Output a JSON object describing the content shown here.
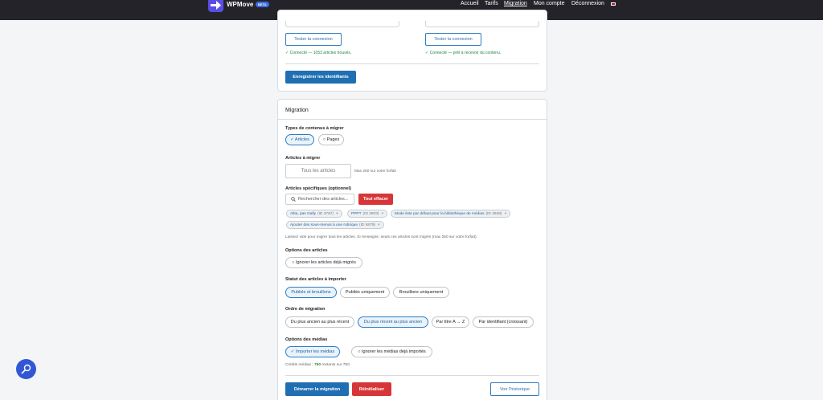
{
  "header": {
    "brand": "WPMove",
    "badge": "BETA",
    "nav": [
      "Accueil",
      "Tarifs",
      "Migration",
      "Mon compte",
      "Déconnexion"
    ],
    "active_nav": "Migration"
  },
  "connection": {
    "test_label": "Tester la connexion",
    "source_status": "✓ Connecté — 1053 articles trouvés.",
    "dest_status": "✓ Connecté — prêt à recevoir du contenu.",
    "save_label": "Enregistrer les identifiants"
  },
  "migration": {
    "title": "Migration",
    "content_types_label": "Types de contenus à migrer",
    "content_types": [
      "✓ Articles",
      "○ Pages"
    ],
    "articles_label": "Articles à migrer",
    "articles_value": "Tous les articles",
    "articles_max": "Max 250 sur votre forfait",
    "specific_label": "Articles spécifiques (optionnel)",
    "search_placeholder": "Rechercher des articles...",
    "clear_label": "Tout effacer",
    "tags": [
      {
        "title": "Alita, pas Gally",
        "id": "(ID 3787)"
      },
      {
        "title": "PPPT",
        "id": "(ID 3803)"
      },
      {
        "title": "Mode liste par défaut pour la bibliothèque de médias",
        "id": "(ID 3638)"
      },
      {
        "title": "Ajouter des sous-menus à une rubrique",
        "id": "(ID 5879)"
      }
    ],
    "help": "Laissez vide pour migrer tous les articles. Si renseigné, seuls ces articles sont migrés (max 250 sur votre forfait).",
    "options_label": "Options des articles",
    "ignore_migrated": "○ Ignorer les articles déjà migrés",
    "status_label": "Statut des articles à importer",
    "statuses": [
      "Publiés et brouillons",
      "Publiés uniquement",
      "Brouillons uniquement"
    ],
    "order_label": "Ordre de migration",
    "orders": [
      "Du plus ancien au plus récent",
      "Du plus récent au plus ancien",
      "Par titre A → Z",
      "Par identifiant (croissant)"
    ],
    "media_label": "Options des médias",
    "media_options": [
      "✓ Importer les médias",
      "○ Ignorer les médias déjà importés"
    ],
    "credits_prefix": "Crédits médias : ",
    "credits_value": "750",
    "credits_suffix": " restants sur 750.",
    "start_label": "Démarrer la migration",
    "reset_label": "Réinitialiser",
    "history_label": "Voir l'historique"
  }
}
